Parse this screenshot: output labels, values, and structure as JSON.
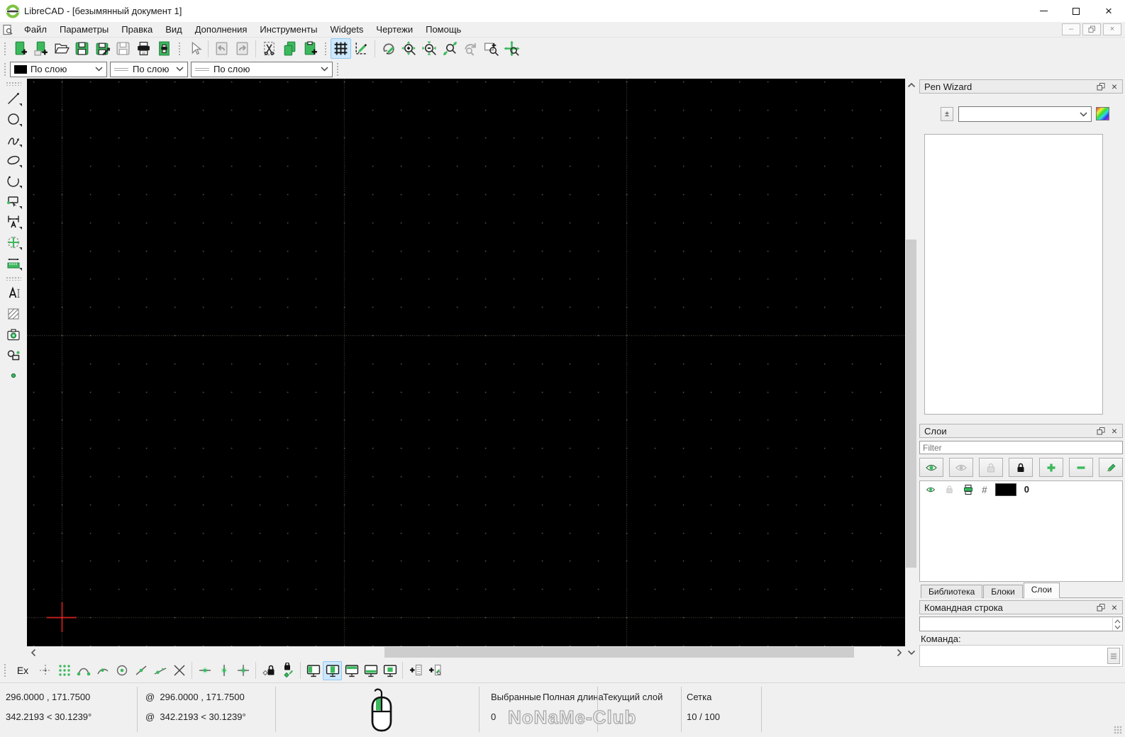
{
  "window": {
    "title": "LibreCAD - [безымянный документ 1]"
  },
  "menu": {
    "items": [
      "Файл",
      "Параметры",
      "Правка",
      "Вид",
      "Дополнения",
      "Инструменты",
      "Widgets",
      "Чертежи",
      "Помощь"
    ]
  },
  "pen_bar": {
    "color_value": "По слою",
    "width_value": "По слою",
    "linetype_value": "По слою"
  },
  "pen_wizard": {
    "title": "Pen Wizard",
    "updown_button": "±",
    "combo_value": ""
  },
  "layers_panel": {
    "title": "Слои",
    "filter_placeholder": "Filter",
    "layers": [
      {
        "name": "0"
      }
    ]
  },
  "dock_tabs": {
    "library": "Библиотека",
    "blocks": "Блоки",
    "layers": "Слои"
  },
  "command_panel": {
    "title": "Командная строка",
    "prompt": "Команда:",
    "history_value": "",
    "input_value": ""
  },
  "snap_bar": {
    "ex_label": "Ex"
  },
  "status_bar": {
    "abs_coord": "296.0000 , 171.7500",
    "abs_polar": "342.2193 < 30.1239°",
    "rel_coord": "@  296.0000 , 171.7500",
    "rel_polar": "@  342.2193 < 30.1239°",
    "selected_label": "Выбранные",
    "total_length_label": "Полная длина",
    "selected_count": "0",
    "current_layer_label": "Текущий слой",
    "grid_label": "Сетка",
    "grid_status": "10 / 100",
    "watermark": "NoNaMe-Club"
  },
  "icons": {
    "close": "×",
    "minimize": "–",
    "construction": "#",
    "names": [
      "app-logo-icon",
      "document-icon",
      "new-file-icon",
      "new-from-template-icon",
      "open-file-icon",
      "save-icon",
      "save-as-icon",
      "save-all-icon",
      "print-icon",
      "print-preview-icon",
      "pointer-icon",
      "undo-icon",
      "redo-icon",
      "cut-icon",
      "copy-icon",
      "paste-icon",
      "grid-icon",
      "draft-mode-icon",
      "redraw-icon",
      "zoom-in-icon",
      "zoom-out-icon",
      "zoom-auto-icon",
      "zoom-previous-icon",
      "zoom-window-icon",
      "zoom-pan-icon",
      "line-tool-icon",
      "circle-tool-icon",
      "spline-tool-icon",
      "ellipse-tool-icon",
      "arc-tool-icon",
      "polyline-tool-icon",
      "dimension-tool-icon",
      "move-tool-icon",
      "measure-tool-icon",
      "text-tool-icon",
      "hatch-tool-icon",
      "image-tool-icon",
      "block-tool-icon",
      "point-tool-icon",
      "snap-free-icon",
      "snap-grid-icon",
      "snap-endpoint-icon",
      "snap-on-entity-icon",
      "snap-center-icon",
      "snap-middle-icon",
      "snap-distance-icon",
      "snap-intersection-icon",
      "restrict-horizontal-icon",
      "restrict-vertical-icon",
      "restrict-orthogonal-icon",
      "lock-relative-zero-icon",
      "set-relative-zero-icon",
      "dock-left-icon",
      "dock-right-icon",
      "dock-top-icon",
      "dock-bottom-icon",
      "dock-floating-icon",
      "eye-icon",
      "lock-icon",
      "printer-icon",
      "add-layer-icon",
      "remove-layer-icon",
      "edit-layer-icon",
      "color-picker-icon",
      "float-panel-icon",
      "mouse-icon"
    ]
  },
  "colors": {
    "accent_green": "#3cb95c",
    "canvas_bg": "#000000",
    "crosshair": "#ff2a2a",
    "active_highlight": "#cde8ff",
    "grid_dot": "#90908a",
    "meta_grid": "#45453e"
  }
}
